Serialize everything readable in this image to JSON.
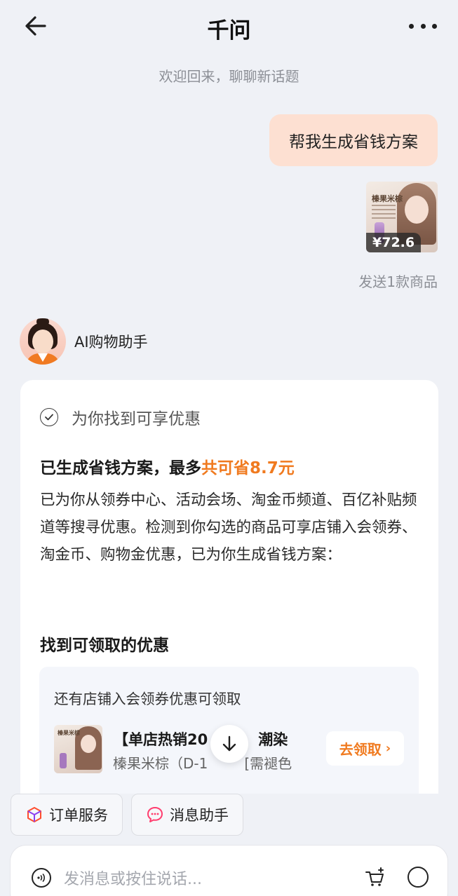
{
  "header": {
    "title": "千问"
  },
  "welcome": "欢迎回来，聊聊新话题",
  "user_message": "帮我生成省钱方案",
  "product": {
    "logo": "榛果米棕",
    "price": "¥72.6"
  },
  "sent_note": "发送1款商品",
  "assistant": {
    "name": "AI购物助手"
  },
  "card": {
    "found": "为你找到可享优惠",
    "plan_title_prefix": "已生成省钱方案，最多",
    "plan_title_highlight": "共可省8.7元",
    "plan_body": "已为你从领券中心、活动会场、淘金币频道、百亿补贴频道等搜寻优惠。检测到你勾选的商品可享店铺入会领券、淘金币、购物金优惠，已为你生成省钱方案：",
    "section_title": "找到可领取的优惠",
    "coupon": {
      "head": "还有店铺入会领券优惠可领取",
      "thumb_logo": "榛果米棕",
      "name": "【单店热销20",
      "name_tail": "潮染",
      "sub": "榛果米棕（D-1",
      "sub_tail": "[需褪色",
      "button": "去领取"
    }
  },
  "quick_actions": [
    {
      "label": "订单服务",
      "icon": "box-icon"
    },
    {
      "label": "消息助手",
      "icon": "chat-icon"
    }
  ],
  "input": {
    "placeholder": "发消息或按住说话..."
  },
  "colors": {
    "accent": "#f07a1f",
    "bubble": "#fde0d2",
    "background": "#eff1f6"
  }
}
